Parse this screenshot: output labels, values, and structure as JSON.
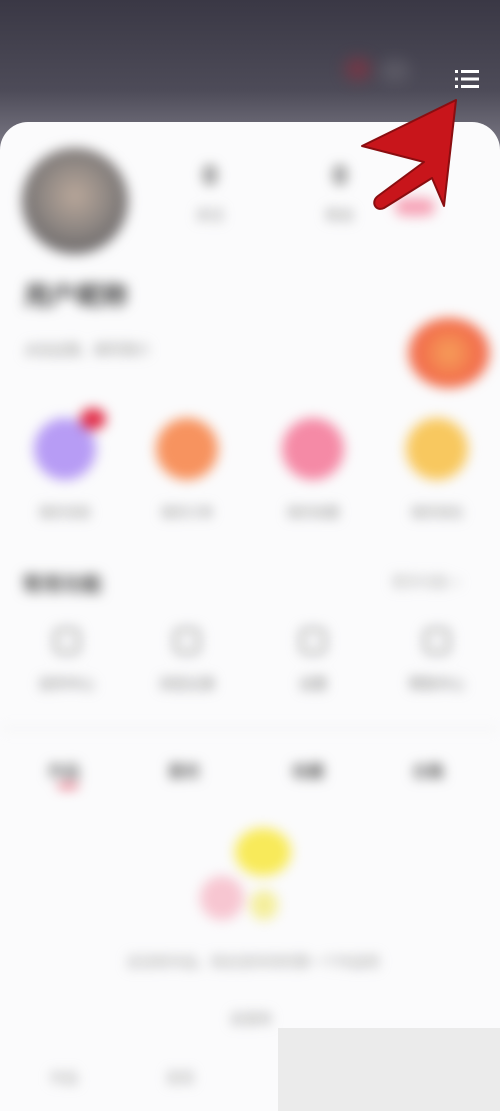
{
  "header": {
    "menu_icon": "list-menu-icon"
  },
  "profile": {
    "avatar": "avatar",
    "stats": [
      {
        "value": "0",
        "label": "关注"
      },
      {
        "value": "0",
        "label": "粉丝"
      }
    ],
    "username": "用户昵称",
    "bio": "点击这里，填写简介"
  },
  "shortcuts": [
    {
      "label": "我的消息",
      "color": "#b79cf5"
    },
    {
      "label": "我的订单",
      "color": "#f7935f"
    },
    {
      "label": "我的收藏",
      "color": "#f58aa6"
    },
    {
      "label": "我的钱包",
      "color": "#f8c85f"
    }
  ],
  "section": {
    "title": "常用功能",
    "more": "更多功能 >",
    "items": [
      {
        "label": "创作中心"
      },
      {
        "label": "浏览记录"
      },
      {
        "label": "设置"
      },
      {
        "label": "帮助中心"
      }
    ]
  },
  "tabs": [
    {
      "label": "作品"
    },
    {
      "label": "喜欢"
    },
    {
      "label": "收藏"
    },
    {
      "label": "合集"
    }
  ],
  "empty_state": {
    "message": "还没有作品，快去发布你的第一个作品吧",
    "button": "去发布"
  },
  "bottom": {
    "left1": "作品",
    "left2": "发现"
  },
  "colors": {
    "accent": "#e2304a",
    "arrow": "#c8151b"
  }
}
